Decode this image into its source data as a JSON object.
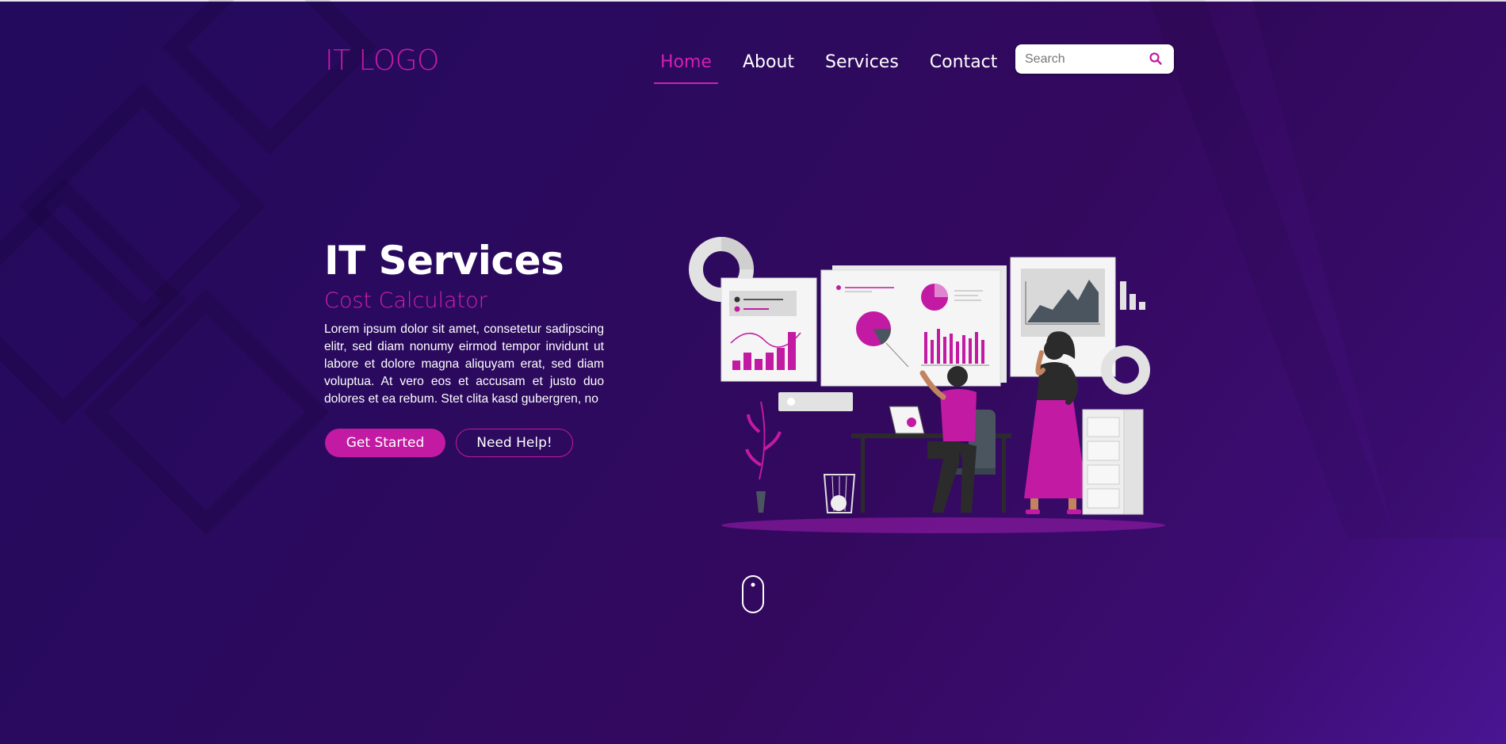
{
  "brand": {
    "logo": "IT LOGO"
  },
  "nav": {
    "items": [
      {
        "label": "Home",
        "active": true
      },
      {
        "label": "About",
        "active": false
      },
      {
        "label": "Services",
        "active": false
      },
      {
        "label": "Contact",
        "active": false
      }
    ]
  },
  "search": {
    "placeholder": "Search",
    "value": ""
  },
  "hero": {
    "title": "IT Services",
    "subtitle": "Cost Calculator",
    "text": "Lorem ipsum dolor sit amet, consetetur sadipscing elitr, sed diam nonumy eirmod tempor invidunt ut labore et dolore magna aliquyam erat, sed diam voluptua. At vero eos et accusam et justo duo dolores et ea rebum. Stet clita kasd gubergren, no",
    "primary_button": "Get Started",
    "secondary_button": "Need Help!"
  },
  "icons": {
    "search": "search-icon",
    "scroll": "mouse-scroll-icon",
    "illustration": "analytics-team-illustration"
  },
  "colors": {
    "accent": "#c21aa2",
    "accent_light": "#d21fb2",
    "background_start": "#230a5c",
    "background_end": "#4a1592",
    "text": "#ffffff"
  }
}
